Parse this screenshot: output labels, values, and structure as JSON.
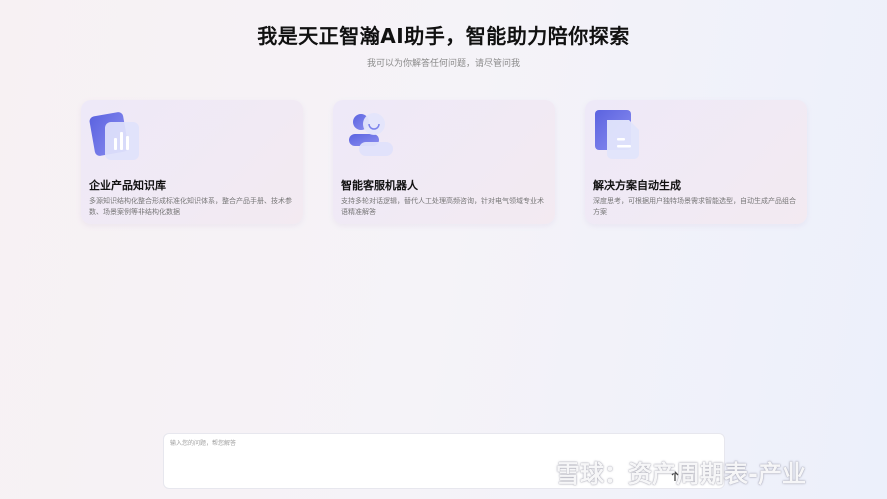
{
  "hero": {
    "title": "我是天正智瀚AI助手，智能助力陪你探索",
    "subtitle": "我可以为你解答任何问题，请尽管问我"
  },
  "cards": [
    {
      "title": "企业产品知识库",
      "desc": "多源知识结构化整合形成标准化知识体系，整合产品手册、技术参数、场景案例等非结构化数据",
      "icon": "chart-document-icon"
    },
    {
      "title": "智能客服机器人",
      "desc": "支持多轮对话逻辑，替代人工处理高频咨询，针对电气领域专业术语精准解答",
      "icon": "robot-avatar-icon"
    },
    {
      "title": "解决方案自动生成",
      "desc": "深度思考，可根据用户独特场景需求智能选型，自动生成产品组合方案",
      "icon": "document-icon"
    }
  ],
  "input": {
    "placeholder": "输入您的问题，帮您解答"
  },
  "watermark": {
    "text": "雪球：资产周期表-产业"
  },
  "colors": {
    "accent": "#6b72e6",
    "card_bg": "#efe9f6"
  }
}
